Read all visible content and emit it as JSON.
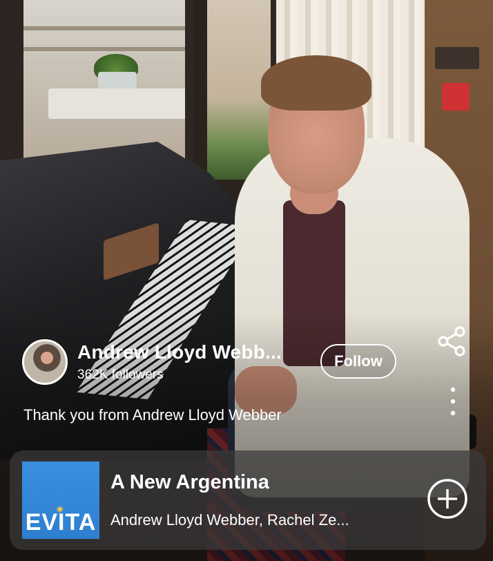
{
  "artist": {
    "name": "Andrew Lloyd Webb...",
    "followers": "362K followers"
  },
  "follow_label": "Follow",
  "caption": "Thank you from Andrew Lloyd Webber",
  "track": {
    "title": "A New Argentina",
    "artists": "Andrew Lloyd Webber, Rachel Ze...",
    "cover_text": "EVITA"
  },
  "icons": {
    "share": "share-icon",
    "more": "more-vertical-icon",
    "add": "add-circle-icon"
  },
  "colors": {
    "cover_blue": "#2f7fd1",
    "text": "#ffffff"
  }
}
